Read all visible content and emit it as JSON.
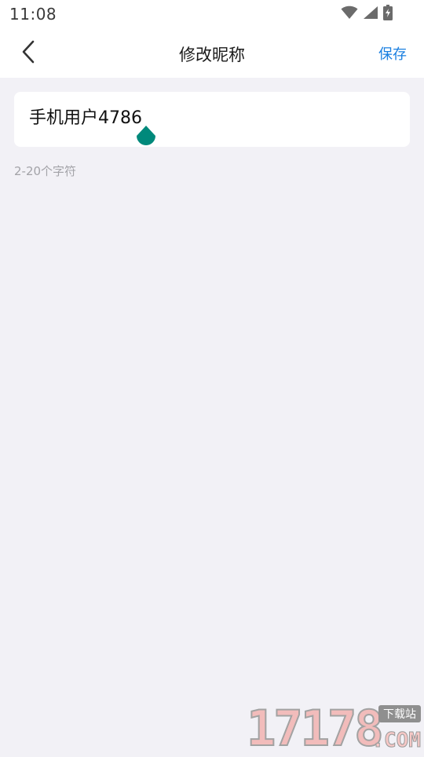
{
  "status_bar": {
    "time": "11:08",
    "icons": [
      "wifi-icon",
      "cellular-signal-icon",
      "battery-charging-icon"
    ]
  },
  "nav_bar": {
    "back_icon": "chevron-left-icon",
    "title": "修改昵称",
    "save_label": "保存"
  },
  "form": {
    "nickname_value": "手机用户4786",
    "hint": "2-20个字符"
  },
  "colors": {
    "accent": "#1a7fe0",
    "cursor_handle": "#00897b",
    "background": "#f2f1f6"
  },
  "watermark": {
    "number": "17178",
    "domain": ".COM",
    "tag": "下载站"
  }
}
